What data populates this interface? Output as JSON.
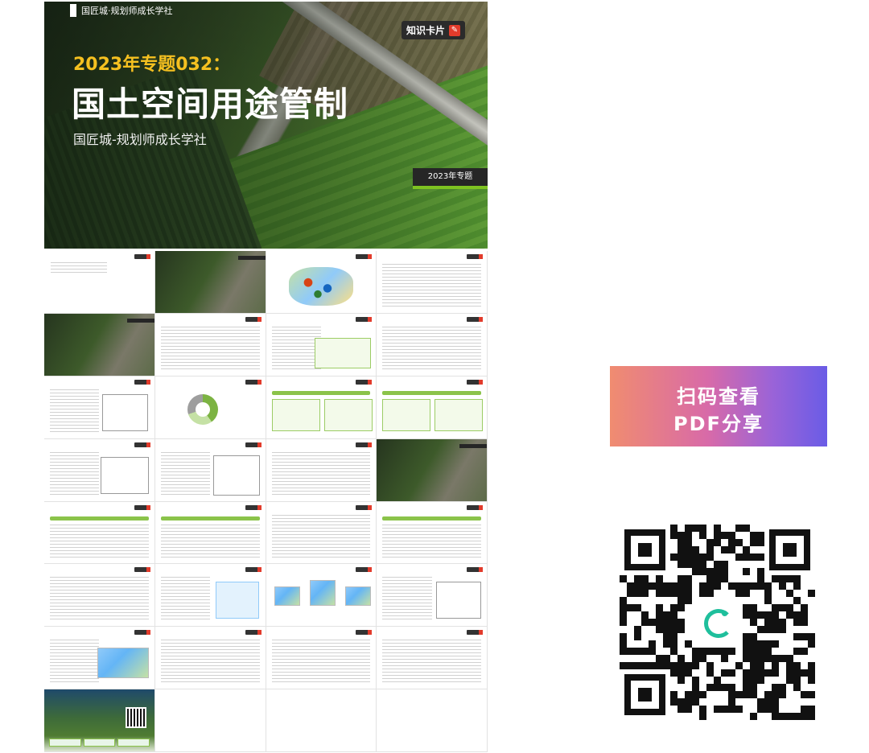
{
  "cover": {
    "brand": "国匠城·规划师成长学社",
    "tag": "知识卡片",
    "topic_label": "2023年专题032：",
    "title": "国土空间用途管制",
    "organization": "国匠城-规划师成长学社",
    "year_badge": "2023年专题"
  },
  "share": {
    "line1": "扫码查看",
    "line2": "PDF分享"
  },
  "colors": {
    "accent_green": "#7ec321",
    "topic_yellow": "#f5c020",
    "qr_center": "#1fbf9c"
  }
}
